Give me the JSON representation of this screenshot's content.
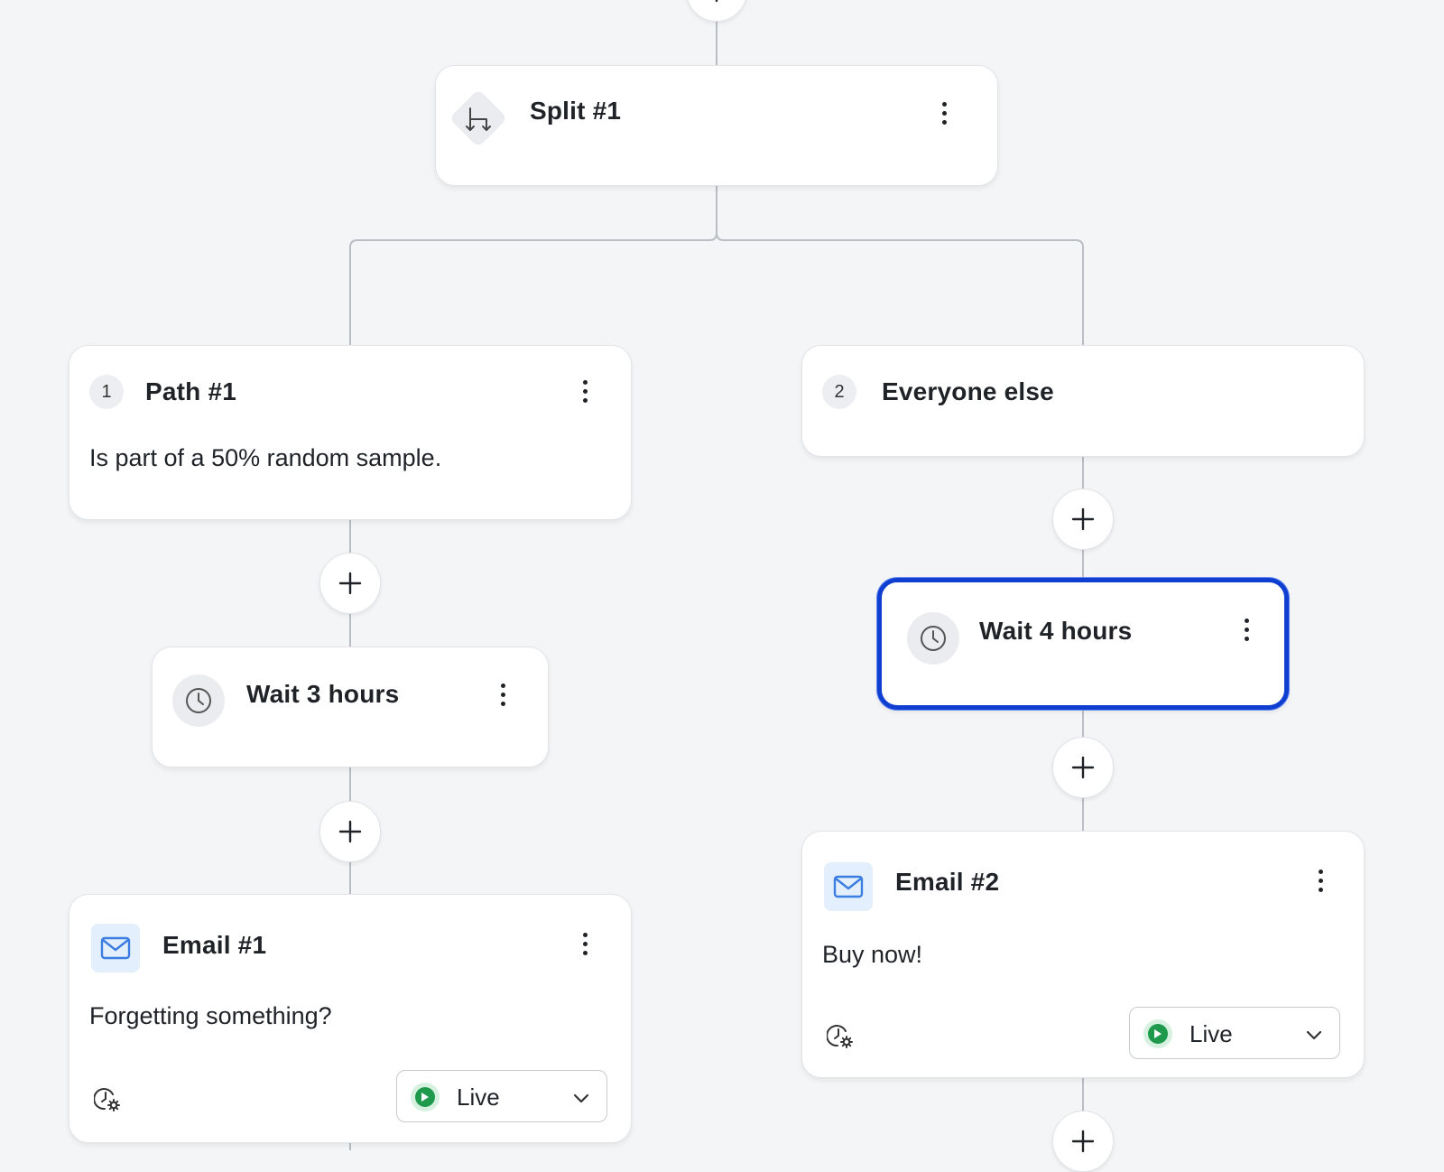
{
  "split": {
    "title": "Split #1",
    "icon": "split-arrows-icon"
  },
  "paths": [
    {
      "number": "1",
      "title": "Path #1",
      "condition": "Is part of a 50% random sample."
    },
    {
      "number": "2",
      "title": "Everyone else"
    }
  ],
  "waits": [
    {
      "title": "Wait 3 hours",
      "icon": "clock-icon"
    },
    {
      "title": "Wait 4 hours",
      "icon": "clock-icon",
      "selected": true
    }
  ],
  "emails": [
    {
      "title": "Email #1",
      "subject": "Forgetting something?",
      "status": "Live",
      "icon": "mail-icon"
    },
    {
      "title": "Email #2",
      "subject": "Buy now!",
      "status": "Live",
      "icon": "mail-icon"
    }
  ],
  "colors": {
    "canvas": "#f4f5f7",
    "selected_border": "#0f3fd0",
    "live_green": "#1f9a4d",
    "mail_blue": "#3b7de0",
    "connector": "#b9bdc4"
  }
}
